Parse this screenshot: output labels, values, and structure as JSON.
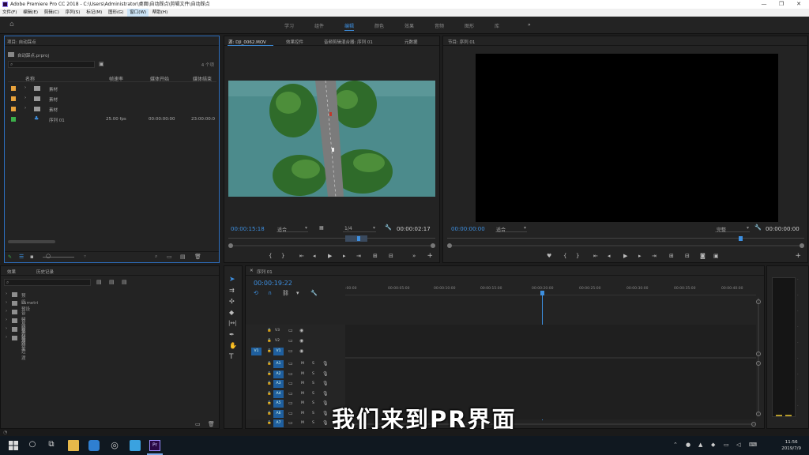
{
  "window": {
    "title": "Adobe Premiere Pro CC 2018 - C:\\Users\\Administrator\\桌面\\自动踩点\\剪辑文件\\自动踩点"
  },
  "menu": [
    "文件(F)",
    "编辑(E)",
    "剪辑(C)",
    "序列(S)",
    "标记(M)",
    "图形(G)",
    "窗口(W)",
    "帮助(H)"
  ],
  "workspaces": [
    "学习",
    "组件",
    "编辑",
    "颜色",
    "效果",
    "音频",
    "图形",
    "库"
  ],
  "active_workspace": "编辑",
  "project": {
    "title": "项目: 自动踩点",
    "file": "自动踩点.prproj",
    "count": "4 个项",
    "columns": [
      "名称",
      "帧速率",
      "媒体开始",
      "媒体结束"
    ],
    "rows": [
      {
        "name": "素材",
        "rate": "",
        "start": "",
        "end": "",
        "color": "#e8a23c"
      },
      {
        "name": "素材",
        "rate": "",
        "start": "",
        "end": "",
        "color": "#e8a23c"
      },
      {
        "name": "素材",
        "rate": "",
        "start": "",
        "end": "",
        "color": "#e8a23c"
      },
      {
        "name": "序列 01",
        "rate": "25.00 fps",
        "start": "00:00:00:00",
        "end": "23:00:00:0",
        "color": "#3bb04a"
      }
    ]
  },
  "effects": {
    "tabs": [
      "效果",
      "历史记录"
    ],
    "items": [
      "预设",
      "Lumetri 预设",
      "音频效果",
      "音频过渡",
      "视频效果",
      "视频过渡"
    ]
  },
  "source": {
    "tabs": [
      "源: DJI_0062.MOV",
      "效果控件",
      "音频剪辑混合器: 序列 01",
      "元数据"
    ],
    "timecode": "00:00:15:18",
    "fit": "适合",
    "zoom": "1/4",
    "duration": "00:00:02:17"
  },
  "program": {
    "tab": "节目: 序列 01",
    "timecode": "00:00:00:00",
    "fit": "适合",
    "quality": "完整",
    "duration": "00:00:00:00"
  },
  "timeline": {
    "tab": "序列 01",
    "timecode": "00:00:19:22",
    "ruler": [
      ":00:00",
      "00:00:05:00",
      "00:00:10:00",
      "00:00:15:00",
      "00:00:20:00",
      "00:00:25:00",
      "00:00:30:00",
      "00:00:35:00",
      "00:00:40:00"
    ],
    "video_tracks": [
      "V3",
      "V2",
      "V1"
    ],
    "audio_tracks": [
      "A1",
      "A2",
      "A3",
      "A4",
      "A5",
      "A6",
      "A7",
      "A8"
    ],
    "source_patch": "V1"
  },
  "subtitle": "我们来到PR界面",
  "taskbar": {
    "time": "11:56",
    "date": "2019/7/9"
  }
}
